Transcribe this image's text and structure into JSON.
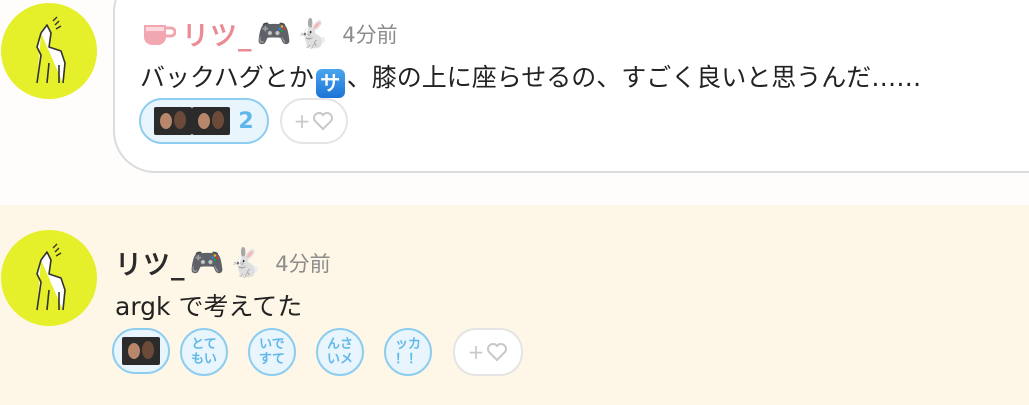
{
  "post1": {
    "username": "リツ_",
    "emojis": [
      "🎮",
      "🐇"
    ],
    "time": "4分前",
    "text_before": "バックハグとか",
    "badge": "サ",
    "text_after": "、膝の上に座らせるの、すごく良いと思うんだ……",
    "reaction_count": "2",
    "add_reaction": "+"
  },
  "post2": {
    "username": "リツ_",
    "emojis": [
      "🎮",
      "🐇"
    ],
    "time": "4分前",
    "text": "argk で考えてた",
    "text_reactions": [
      "とて\nもい",
      "いで\nすて",
      "んさ\nいメ",
      "ッカ\n！！"
    ],
    "add_reaction": "+"
  },
  "colors": {
    "avatar": "#e5f02a",
    "post2_background": "#fef6e6",
    "reaction_border": "#8dcdf0",
    "pink_username": "#e98a95"
  }
}
